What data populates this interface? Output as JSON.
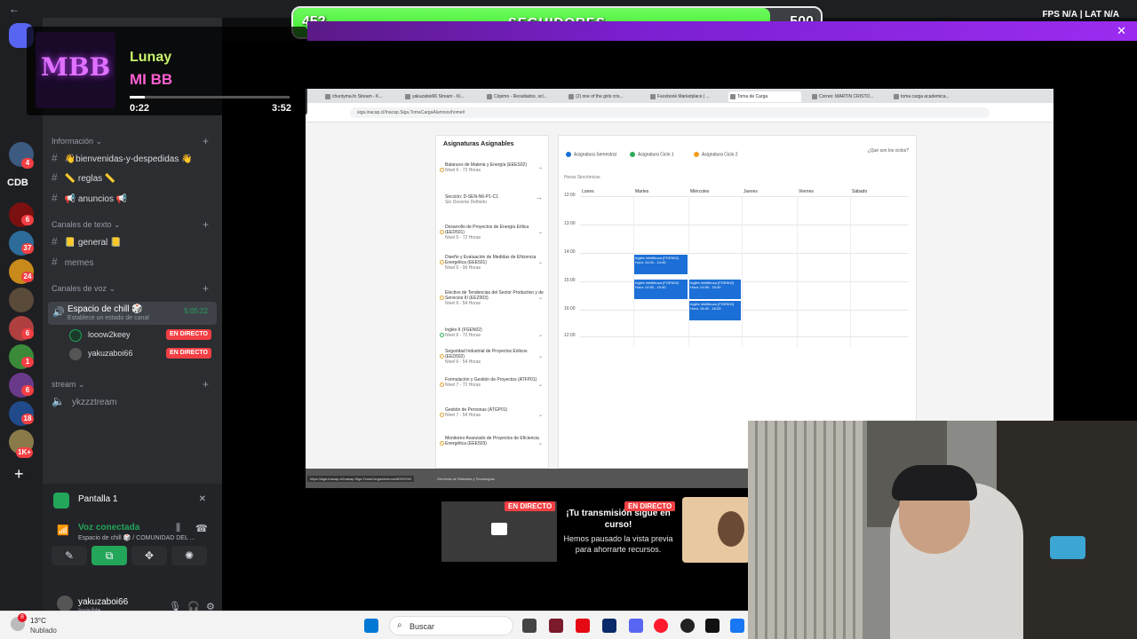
{
  "goal": {
    "current": "452",
    "label": "SEGUIDORES",
    "target": "500",
    "progress": 0.904
  },
  "topbar": {
    "fps": "FPS",
    "fps_value": "N/A",
    "lat": "LAT",
    "lat_value": "N/A"
  },
  "music": {
    "logo": "MBB",
    "artist": "Lunay",
    "song": "MI BB",
    "elapsed": "0:22",
    "duration": "3:52",
    "progress": 0.095
  },
  "rail": {
    "cdb_label": "CDB",
    "badges": [
      "4",
      "6",
      "37",
      "24",
      "6",
      "1",
      "6",
      "18",
      "1K+"
    ]
  },
  "sidebar": {
    "cat_info": "Información",
    "channels_info": [
      "👋bienvenidas-y-despedidas 👋",
      "📏 reglas 📏",
      "📢 anuncios 📢"
    ],
    "cat_text": "Canales de texto",
    "channels_text": [
      "📒 general 📒",
      "memes"
    ],
    "cat_voice": "Canales de voz",
    "voice_channel": {
      "name": "Espacio de chill 🎲",
      "status": "Establece un estado de canal",
      "time": "5:05:22"
    },
    "voice_users": [
      {
        "name": "looow2keey",
        "badge": "EN DIRECTO"
      },
      {
        "name": "yakuzaboi66",
        "badge": "EN DIRECTO"
      }
    ],
    "cat_stream": "stream",
    "stream_channel": "ykzzztream"
  },
  "panel": {
    "screen": "Pantalla 1",
    "voice_title": "Voz conectada",
    "voice_sub": "Espacio de chill 🎲 / COMUNIDAD DEL ..."
  },
  "user": {
    "name": "yakuzaboi66",
    "status": "Invisible"
  },
  "browser": {
    "tabs": [
      "chuntyma.fo Stream - K...",
      "yakuzaboi66 Stream - Ki...",
      "Cópimo - Resultados, scl...",
      "(2) one of the girls cris...",
      "Facebook Marketplace | ...",
      "Toma de Carga",
      "Correo: MARTIN CRISTO...",
      "toma carga academica..."
    ],
    "url": "siga.inacap.cl/Inacap.Siga.TomaCargaAlumnos/home#",
    "assign_title": "Asignaturas Asignables",
    "courses": [
      {
        "name": "Balances de Materia y Energía (EEES02)",
        "level": "Nivel 6 - 72 Horas"
      },
      {
        "name": "Sección: D-SEN-N6-P1-C1",
        "level": "Sin Docente Definido"
      },
      {
        "name": "Desarrollo de Proyectos de Energía Eólica (EED501)",
        "level": "Nivel 6 - 72 Horas"
      },
      {
        "name": "Diseño y Evaluación de Medidas de Eficiencia Energética (EEE501)",
        "level": "Nivel 6 - 90 Horas"
      },
      {
        "name": "Electivo de Tendencias del Sector Productivo y de Servicios III (EEZ003)",
        "level": "Nivel 6 - 54 Horas"
      },
      {
        "name": "Inglés II (FGEN02)",
        "level": "Nivel 6 - 72 Horas"
      },
      {
        "name": "Seguridad Industrial de Proyectos Eólicos (EED502)",
        "level": "Nivel 6 - 54 Horas"
      },
      {
        "name": "Formulación y Gestión de Proyectos (ATFP01)",
        "level": "Nivel 7 - 72 Horas"
      },
      {
        "name": "Gestión de Personas (ATGP01)",
        "level": "Nivel 7 - 54 Horas"
      },
      {
        "name": "Monitoreo Avanzado de Proyectos de Eficiencia Energética (EEE503)",
        "level": ""
      }
    ],
    "legend": [
      "Asignatura Semestral",
      "Asignatura Ciclo 1",
      "Asignatura Ciclo 2"
    ],
    "legend_colors": [
      "#1b6fd6",
      "#2dab55",
      "#f39c1f"
    ],
    "help": "¿Qué son los ciclos?",
    "hours_label": "Horas Sincrónicas",
    "days": [
      "Lunes",
      "Martes",
      "Miércoles",
      "Jueves",
      "Viernes",
      "Sábado"
    ],
    "hours": [
      "12:00",
      "13:00",
      "14:00",
      "15:00",
      "16:00",
      "12:00"
    ],
    "blocks": [
      "Inglés Intellibuca (FGEN02) Hora: 14:00 - 14:45",
      "Inglés Intellibuca (FGEN02) Hora: 14:55 - 15:40",
      "Inglés Intellibuca (FGEN02) Hora: 14:55 - 15:40",
      "Inglés Intellibuca (FGEN02) Hora: 15:40 - 16:25"
    ],
    "status_url": "https://siga.inacap.cl/Inacap.Siga.TomaCargaAlumnos/#EEES02",
    "footer": "Gerencia de Sistemas y Tecnologías"
  },
  "pause": {
    "live": "EN DIRECTO",
    "live2": "EN DIRECTO",
    "title": "¡Tu transmisión sigue en curso!",
    "sub": "Hemos pausado la vista previa para ahorrarte recursos."
  },
  "taskbar": {
    "temp": "13°C",
    "condition": "Nublado",
    "badge": "8",
    "search": "Buscar"
  }
}
